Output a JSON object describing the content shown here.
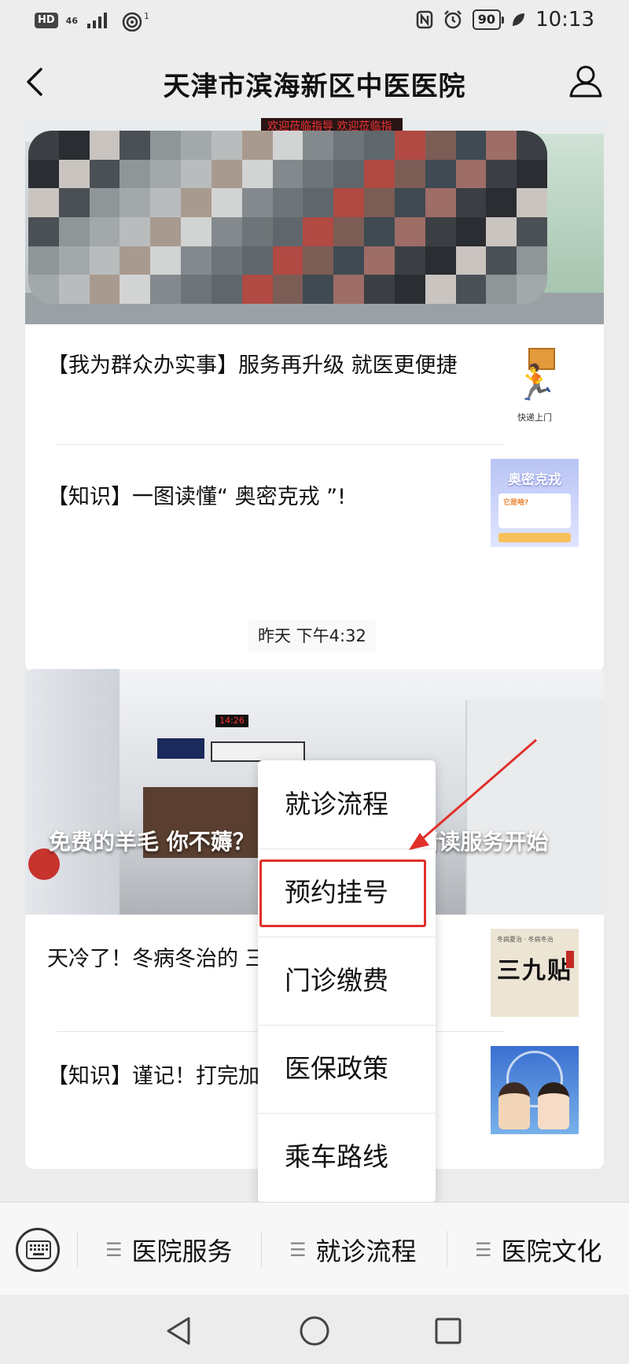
{
  "status_bar": {
    "hd": "HD",
    "network": "46",
    "wifi_badge": "1",
    "battery": "90",
    "time": "10:13"
  },
  "header": {
    "title": "天津市滨海新区中医医院"
  },
  "messages": {
    "card1": {
      "articles": [
        {
          "title": "【我为群众办实事】服务再升级 就医更便捷",
          "thumb_caption": "快递上门"
        },
        {
          "title": "【知识】一图读懂“ 奥密克戎 ”!",
          "thumb_title": "奥密克戎",
          "thumb_label": "它是啥?"
        }
      ]
    },
    "timestamp": "昨天 下午4:32",
    "card2": {
      "hero_title": "免费的羊毛 你不薅？ 报告线上、线下精读服务开始",
      "hero_clock": "14:26",
      "articles": [
        {
          "title": "天冷了！冬病冬治的 三九贴上了",
          "thumb_text": "三九贴"
        },
        {
          "title": "【知识】谨记！打完加强针 口罩！"
        }
      ]
    }
  },
  "submenu": {
    "items": [
      "就诊流程",
      "预约挂号",
      "门诊缴费",
      "医保政策",
      "乘车路线"
    ],
    "highlighted_index": 1
  },
  "bottom_menu": {
    "tabs": [
      "医院服务",
      "就诊流程",
      "医院文化"
    ],
    "highlighted_index": 1
  },
  "colors": {
    "highlight": "#e0302a",
    "background": "#ececec"
  }
}
